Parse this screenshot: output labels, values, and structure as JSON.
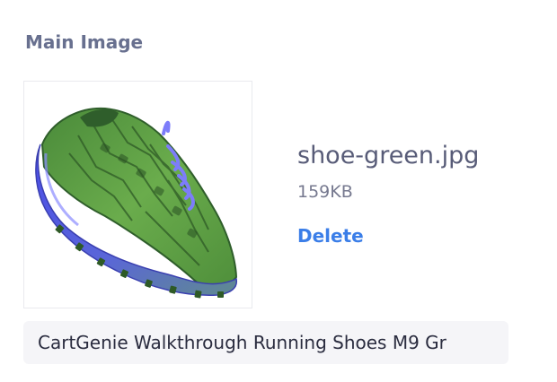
{
  "section": {
    "label": "Main Image"
  },
  "image": {
    "icon": "green-running-shoe-photo",
    "colors": {
      "upper": "#5f9e45",
      "upper_dark": "#2f5e2b",
      "sole": "#5b5cf0",
      "laces": "#7d7dfa"
    }
  },
  "file": {
    "name": "shoe-green.jpg",
    "size": "159KB",
    "delete_label": "Delete"
  },
  "caption": {
    "text": "CartGenie Walkthrough Running Shoes M9 Gr"
  },
  "colors": {
    "label": "#68708f",
    "filename": "#585c78",
    "filesize": "#76798f",
    "link": "#3b7ee8",
    "caption_bg": "#f5f5f8"
  }
}
